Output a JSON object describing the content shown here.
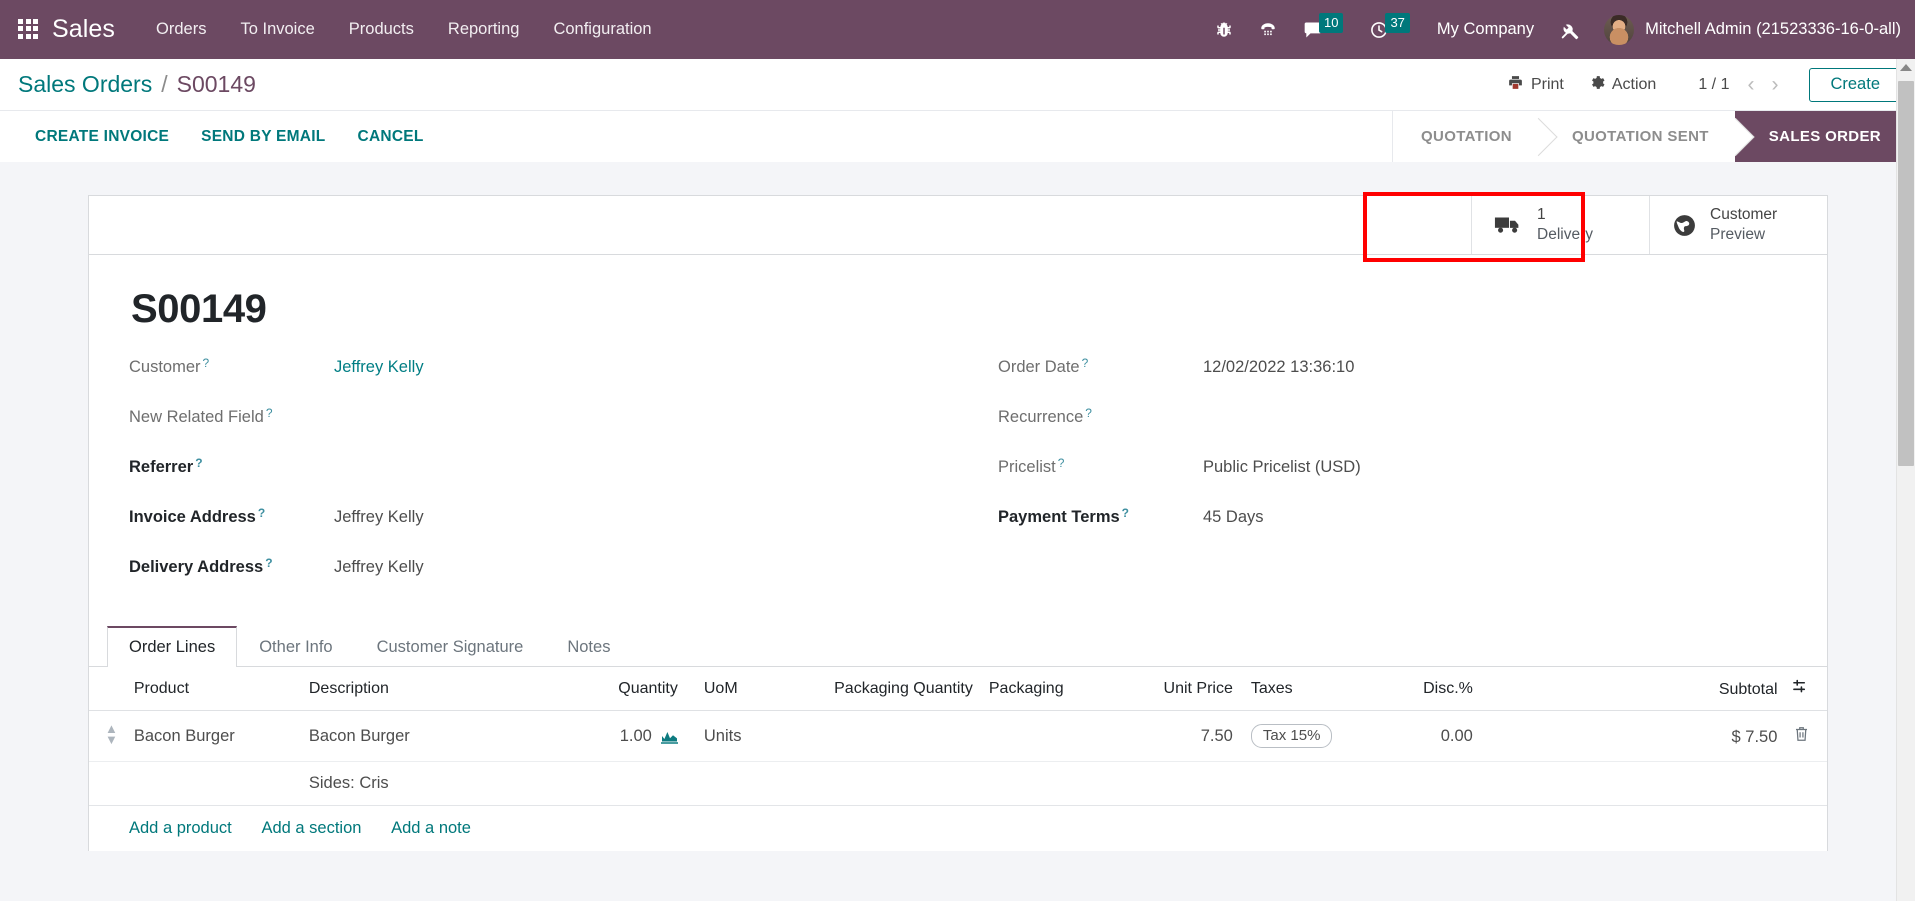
{
  "navbar": {
    "apps_icon": "apps-grid-icon",
    "brand": "Sales",
    "menus": [
      "Orders",
      "To Invoice",
      "Products",
      "Reporting",
      "Configuration"
    ],
    "sys_icons": [
      {
        "name": "bug-icon",
        "glyph": "🐞"
      },
      {
        "name": "voip-phone-icon",
        "glyph": "☎"
      },
      {
        "name": "messages-icon",
        "glyph": "💬",
        "badge": "10"
      },
      {
        "name": "activities-clock-icon",
        "glyph": "🕗",
        "badge": "37"
      }
    ],
    "messages_badge": "10",
    "activities_badge": "37",
    "company": "My Company",
    "debug_icon": "wrench-screwdriver-icon",
    "user": "Mitchell Admin (21523336-16-0-all)",
    "bg_color": "#6c4962"
  },
  "control_panel": {
    "breadcrumb_root": "Sales Orders",
    "breadcrumb_sep": "/",
    "breadcrumb_current": "S00149",
    "print_label": "Print",
    "action_label": "Action",
    "pager": "1 / 1",
    "prev_arrow": "‹",
    "next_arrow": "›",
    "create_label": "Create"
  },
  "action_buttons": [
    "CREATE INVOICE",
    "SEND BY EMAIL",
    "CANCEL"
  ],
  "statusbar": {
    "stages": [
      {
        "label": "Quotation",
        "active": false
      },
      {
        "label": "Quotation Sent",
        "active": false
      },
      {
        "label": "Sales Order",
        "active": true
      }
    ]
  },
  "smart_buttons": [
    {
      "icon": "truck-delivery-icon",
      "count": "1",
      "label": "Delivery",
      "highlighted": true
    },
    {
      "icon": "globe-icon",
      "count": "Customer",
      "label": "Preview",
      "highlighted": false
    }
  ],
  "highlight_color": "#ff0000",
  "record": {
    "title": "S00149",
    "left_fields": [
      {
        "label": "Customer",
        "value": "Jeffrey Kelly",
        "required": false,
        "is_link": true,
        "help": "?"
      },
      {
        "label": "New Related Field",
        "value": "",
        "required": false,
        "is_link": false,
        "help": "?"
      },
      {
        "label": "Referrer",
        "value": "",
        "required": true,
        "is_link": false,
        "help": "?"
      },
      {
        "label": "Invoice Address",
        "value": "Jeffrey Kelly",
        "required": true,
        "is_link": false,
        "help": "?"
      },
      {
        "label": "Delivery Address",
        "value": "Jeffrey Kelly",
        "required": true,
        "is_link": false,
        "help": "?"
      }
    ],
    "right_fields": [
      {
        "label": "Order Date",
        "value": "12/02/2022 13:36:10",
        "required": false,
        "is_link": false,
        "help": "?"
      },
      {
        "label": "Recurrence",
        "value": "",
        "required": false,
        "is_link": false,
        "help": "?"
      },
      {
        "label": "Pricelist",
        "value": "Public Pricelist (USD)",
        "required": false,
        "is_link": false,
        "help": "?"
      },
      {
        "label": "Payment Terms",
        "value": "45 Days",
        "required": true,
        "is_link": false,
        "help": "?"
      }
    ]
  },
  "notebook": {
    "tabs": [
      {
        "label": "Order Lines",
        "active": true
      },
      {
        "label": "Other Info",
        "active": false
      },
      {
        "label": "Customer Signature",
        "active": false
      },
      {
        "label": "Notes",
        "active": false
      }
    ]
  },
  "order_lines": {
    "columns": [
      "Product",
      "Description",
      "Quantity",
      "UoM",
      "Packaging Quantity",
      "Packaging",
      "Unit Price",
      "Taxes",
      "Disc.%",
      "Subtotal"
    ],
    "optional_columns_icon": "column-options-icon",
    "rows": [
      {
        "handle": "drag-handle-icon",
        "product": "Bacon Burger",
        "description": "Bacon Burger",
        "quantity": "1.00",
        "qty_widget_icon": "sparkline-forecast-icon",
        "uom": "Units",
        "packaging_quantity": "",
        "packaging": "",
        "unit_price": "7.50",
        "taxes": "Tax 15%",
        "discount": "0.00",
        "subtotal": "$ 7.50",
        "delete_icon": "trash-icon",
        "sub_description": "Sides: Cris"
      }
    ],
    "add_links": [
      "Add a product",
      "Add a section",
      "Add a note"
    ]
  }
}
